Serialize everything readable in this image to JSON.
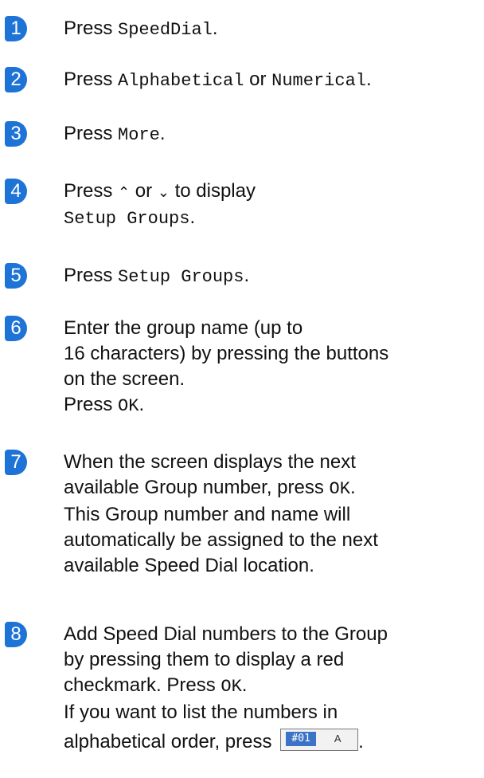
{
  "steps": [
    {
      "n": "1",
      "press": "Press",
      "target": "SpeedDial",
      "end": "."
    },
    {
      "n": "2",
      "press": "Press",
      "a": "Alphabetical",
      "or": "or",
      "b": "Numerical",
      "end": "."
    },
    {
      "n": "3",
      "press": "Press",
      "target": "More",
      "end": "."
    },
    {
      "n": "4",
      "press": "Press",
      "up": "⌃",
      "or": "or",
      "down": "⌄",
      "rest": "to display",
      "target": "Setup Groups",
      "end": "."
    },
    {
      "n": "5",
      "press": "Press",
      "target": "Setup Groups",
      "end": "."
    },
    {
      "n": "6",
      "l1": "Enter the group name (up to",
      "l2": "16 characters) by pressing the buttons",
      "l3": "on the screen.",
      "press": "Press",
      "ok": "OK",
      "end": "."
    },
    {
      "n": "7",
      "l1a": "When the screen displays the next",
      "l2a": "available Group number, press",
      "ok": "OK",
      "end": ".",
      "l3": "This Group number and name will",
      "l4": "automatically be assigned to the next",
      "l5": "available Speed Dial location."
    },
    {
      "n": "8",
      "l1": "Add Speed Dial numbers to the Group",
      "l2": "by pressing them to display a red",
      "l3a": "checkmark. Press",
      "ok": "OK",
      "end": ".",
      "l4": "If you want to list the numbers in",
      "l5": "alphabetical order, press",
      "end2": ".",
      "icon_left": "#01",
      "icon_right": "A"
    }
  ]
}
